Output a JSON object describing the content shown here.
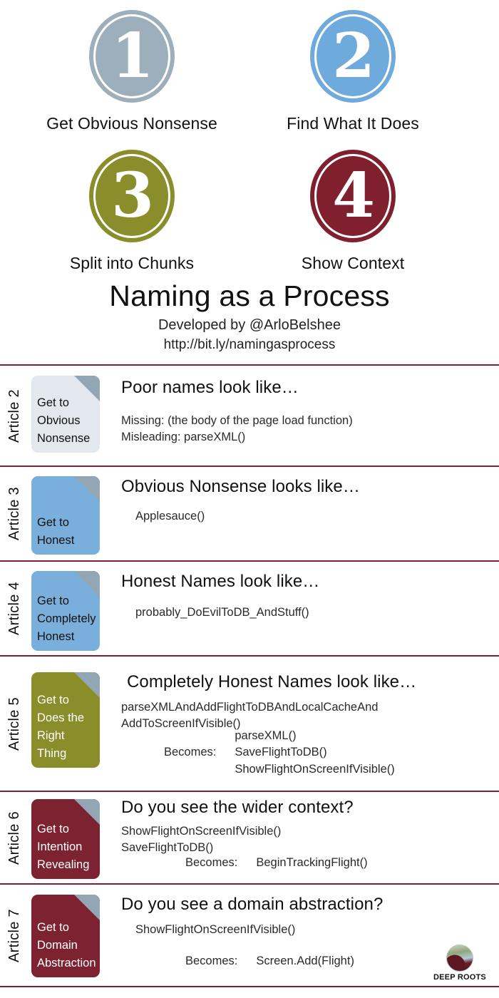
{
  "colors": {
    "step1": "#9dafbb",
    "step2": "#6faadc",
    "step3": "#8a8e2a",
    "step4": "#80202f",
    "divider": "#7d1f2e",
    "fold": "#92a6b3",
    "card_light": "#e2e8ed",
    "card_blue": "#7bafdb",
    "card_olive": "#8a8e2a",
    "card_maroon": "#7d2231"
  },
  "steps": [
    {
      "number": "1",
      "label": "Get Obvious Nonsense",
      "color": "#9dafbb"
    },
    {
      "number": "2",
      "label": "Find What It Does",
      "color": "#6faadc"
    },
    {
      "number": "3",
      "label": "Split into Chunks",
      "color": "#8a8e2a"
    },
    {
      "number": "4",
      "label": "Show Context",
      "color": "#80202f"
    }
  ],
  "title": {
    "main": "Naming as a Process",
    "subtitle": "Developed by @ArloBelshee",
    "url": "http://bit.ly/namingasprocess"
  },
  "articles": [
    {
      "tag": "Article 2",
      "card_lines": [
        "Get to",
        "Obvious",
        "Nonsense"
      ],
      "card_bg": "#e2e8ed",
      "card_text_color": "#111111",
      "heading": "Poor names look like…",
      "lines": [
        "Missing: (the body of the page load function)",
        "Misleading: parseXML()"
      ],
      "becomes_label": "",
      "becomes_values": []
    },
    {
      "tag": "Article 3",
      "card_lines": [
        "Get to",
        "Honest"
      ],
      "card_bg": "#7bafdb",
      "card_text_color": "#111111",
      "heading": "Obvious Nonsense looks like…",
      "lines": [
        "Applesauce()"
      ],
      "becomes_label": "",
      "becomes_values": []
    },
    {
      "tag": "Article 4",
      "card_lines": [
        "Get to",
        "Completely",
        "Honest"
      ],
      "card_bg": "#7bafdb",
      "card_text_color": "#111111",
      "heading": "Honest Names look like…",
      "lines": [
        "probably_DoEvilToDB_AndStuff()"
      ],
      "becomes_label": "",
      "becomes_values": []
    },
    {
      "tag": "Article 5",
      "card_lines": [
        "Get to",
        "Does the",
        "Right Thing"
      ],
      "card_bg": "#8a8e2a",
      "card_text_color": "#ffffff",
      "heading": "Completely Honest Names look like…",
      "lines": [
        "parseXMLAndAddFlightToDBAndLocalCacheAnd",
        "AddToScreenIfVisible()"
      ],
      "becomes_label": "Becomes:",
      "becomes_values": [
        "parseXML()",
        "SaveFlightToDB()",
        "ShowFlightOnScreenIfVisible()"
      ]
    },
    {
      "tag": "Article 6",
      "card_lines": [
        "Get to",
        "Intention",
        "Revealing"
      ],
      "card_bg": "#7d2231",
      "card_text_color": "#ffffff",
      "heading": "Do you see the wider context?",
      "lines": [
        "ShowFlightOnScreenIfVisible()",
        "SaveFlightToDB()"
      ],
      "becomes_label": "Becomes:",
      "becomes_values": [
        "BeginTrackingFlight()"
      ]
    },
    {
      "tag": "Article 7",
      "card_lines": [
        "Get to",
        "Domain",
        "Abstraction"
      ],
      "card_bg": "#7d2231",
      "card_text_color": "#ffffff",
      "heading": "Do you see a domain abstraction?",
      "lines": [
        "ShowFlightOnScreenIfVisible()"
      ],
      "becomes_label": "Becomes:",
      "becomes_values": [
        "Screen.Add(Flight)"
      ]
    }
  ],
  "logo": {
    "text": "DEEP ROOTS",
    "mark": "tree-roots-icon"
  }
}
